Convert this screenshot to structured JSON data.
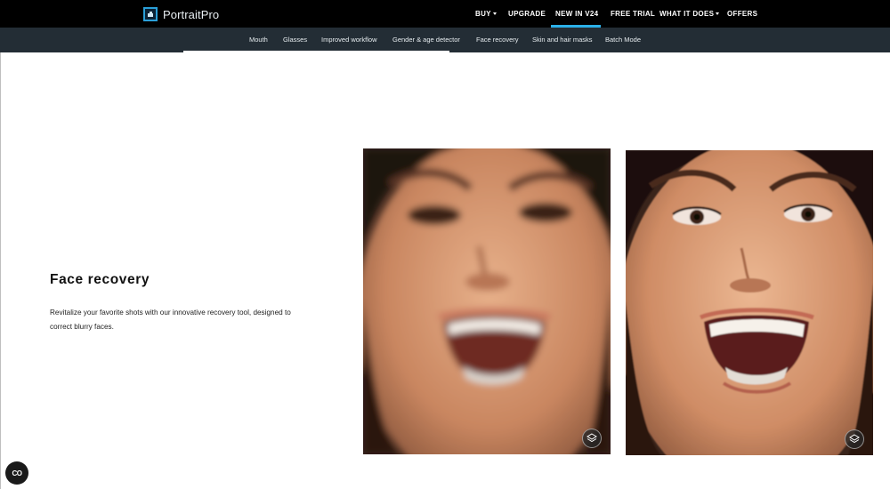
{
  "brand": {
    "name": "PortraitPro"
  },
  "top_nav": {
    "items": [
      {
        "label": "BUY",
        "has_dropdown": true
      },
      {
        "label": "UPGRADE",
        "has_dropdown": false
      },
      {
        "label": "NEW IN V24",
        "has_dropdown": false,
        "active": true
      },
      {
        "label": "FREE TRIAL",
        "has_dropdown": false
      },
      {
        "label": "WHAT IT DOES",
        "has_dropdown": true
      },
      {
        "label": "OFFERS",
        "has_dropdown": false
      }
    ]
  },
  "sub_nav": {
    "items": [
      {
        "label": "Mouth"
      },
      {
        "label": "Glasses"
      },
      {
        "label": "Improved workflow"
      },
      {
        "label": "Gender & age detector"
      },
      {
        "label": "Face recovery"
      },
      {
        "label": "Skin and hair masks"
      },
      {
        "label": "Batch Mode"
      }
    ]
  },
  "feature": {
    "title": "Face recovery",
    "description": "Revitalize your favorite shots with our innovative recovery tool, designed to correct blurry faces."
  },
  "images": [
    {
      "state": "before",
      "icon": "layers-icon"
    },
    {
      "state": "after",
      "icon": "layers-icon"
    }
  ],
  "cookie_button": {
    "label": "CO",
    "icon": "cookie-consent-icon"
  },
  "colors": {
    "topbar": "#000000",
    "subbar": "#232d35",
    "accent": "#2bb0e8"
  }
}
